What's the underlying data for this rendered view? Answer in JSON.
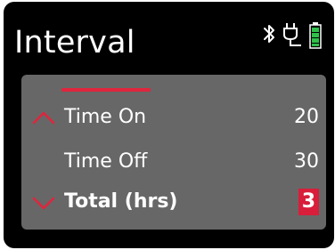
{
  "screen": {
    "title": "Interval",
    "status": {
      "bluetooth_icon": "bluetooth-icon",
      "plug_icon": "power-plug-icon",
      "battery_icon": "battery-icon"
    }
  },
  "settings": {
    "rows": [
      {
        "label": "Time On",
        "value": "20",
        "indicator": "chevron-up-icon"
      },
      {
        "label": "Time Off",
        "value": "30",
        "indicator": ""
      },
      {
        "label": "Total (hrs)",
        "value": "3",
        "indicator": "chevron-down-icon"
      }
    ]
  },
  "colors": {
    "accent": "#e0253d",
    "panel": "#676767",
    "background": "#000000",
    "battery": "#2fbf4a"
  }
}
